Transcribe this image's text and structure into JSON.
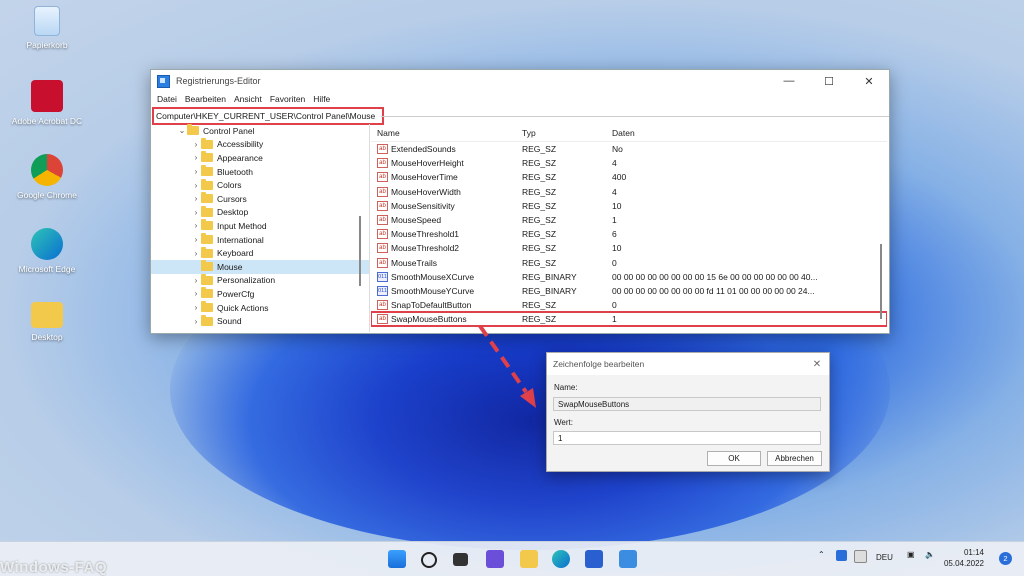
{
  "desktop": {
    "icons": [
      {
        "label": "Papierkorb"
      },
      {
        "label": "Adobe Acrobat DC"
      },
      {
        "label": "Google Chrome"
      },
      {
        "label": "Microsoft Edge"
      },
      {
        "label": "Desktop"
      }
    ]
  },
  "regedit": {
    "title": "Registrierungs-Editor",
    "menu": [
      "Datei",
      "Bearbeiten",
      "Ansicht",
      "Favoriten",
      "Hilfe"
    ],
    "address": "Computer\\HKEY_CURRENT_USER\\Control Panel\\Mouse",
    "tree": {
      "root": "Control Panel",
      "items": [
        "Accessibility",
        "Appearance",
        "Bluetooth",
        "Colors",
        "Cursors",
        "Desktop",
        "Input Method",
        "International",
        "Keyboard",
        "Mouse",
        "Personalization",
        "PowerCfg",
        "Quick Actions",
        "Sound"
      ],
      "selected": "Mouse"
    },
    "columns": {
      "name": "Name",
      "type": "Typ",
      "data": "Daten"
    },
    "values": [
      {
        "name": "ExtendedSounds",
        "type": "REG_SZ",
        "data": "No",
        "kind": "sz"
      },
      {
        "name": "MouseHoverHeight",
        "type": "REG_SZ",
        "data": "4",
        "kind": "sz"
      },
      {
        "name": "MouseHoverTime",
        "type": "REG_SZ",
        "data": "400",
        "kind": "sz"
      },
      {
        "name": "MouseHoverWidth",
        "type": "REG_SZ",
        "data": "4",
        "kind": "sz"
      },
      {
        "name": "MouseSensitivity",
        "type": "REG_SZ",
        "data": "10",
        "kind": "sz"
      },
      {
        "name": "MouseSpeed",
        "type": "REG_SZ",
        "data": "1",
        "kind": "sz"
      },
      {
        "name": "MouseThreshold1",
        "type": "REG_SZ",
        "data": "6",
        "kind": "sz"
      },
      {
        "name": "MouseThreshold2",
        "type": "REG_SZ",
        "data": "10",
        "kind": "sz"
      },
      {
        "name": "MouseTrails",
        "type": "REG_SZ",
        "data": "0",
        "kind": "sz"
      },
      {
        "name": "SmoothMouseXCurve",
        "type": "REG_BINARY",
        "data": "00 00 00 00 00 00 00 00 15 6e 00 00 00 00 00 00 40...",
        "kind": "bin"
      },
      {
        "name": "SmoothMouseYCurve",
        "type": "REG_BINARY",
        "data": "00 00 00 00 00 00 00 00 fd 11 01 00 00 00 00 00 24...",
        "kind": "bin"
      },
      {
        "name": "SnapToDefaultButton",
        "type": "REG_SZ",
        "data": "0",
        "kind": "sz"
      },
      {
        "name": "SwapMouseButtons",
        "type": "REG_SZ",
        "data": "1",
        "kind": "sz"
      }
    ],
    "highlighted_value": "SwapMouseButtons"
  },
  "dialog": {
    "title": "Zeichenfolge bearbeiten",
    "name_label": "Name:",
    "name_value": "SwapMouseButtons",
    "value_label": "Wert:",
    "value_value": "1",
    "ok": "OK",
    "cancel": "Abbrechen"
  },
  "taskbar": {
    "language": "DEU",
    "time": "01:14",
    "date": "05.04.2022",
    "notifications": "2"
  },
  "watermark": "Windows-FAQ",
  "colors": {
    "highlight": "#e0404a",
    "accent": "#2a6fd9"
  }
}
